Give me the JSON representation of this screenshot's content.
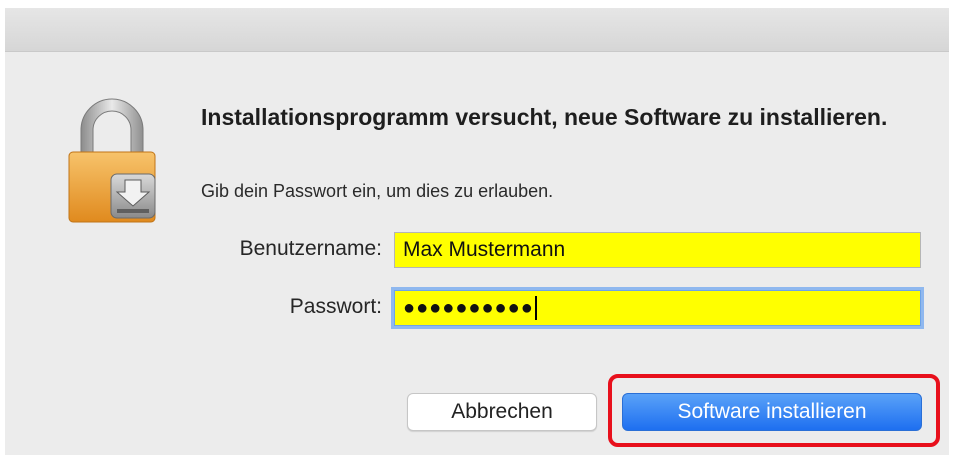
{
  "dialog": {
    "headline": "Installationsprogramm versucht, neue Software zu installieren.",
    "subtext": "Gib dein Passwort ein, um dies zu erlauben."
  },
  "icon": {
    "name": "lock-install-icon"
  },
  "form": {
    "username_label": "Benutzername:",
    "username_value": "Max Mustermann",
    "password_label": "Passwort:",
    "password_masked": "●●●●●●●●●●"
  },
  "buttons": {
    "cancel_label": "Abbrechen",
    "install_label": "Software installieren"
  },
  "colors": {
    "field_highlight": "#ffff00",
    "primary_button": "#2b7bf3",
    "annotation_border": "#e8101c"
  }
}
